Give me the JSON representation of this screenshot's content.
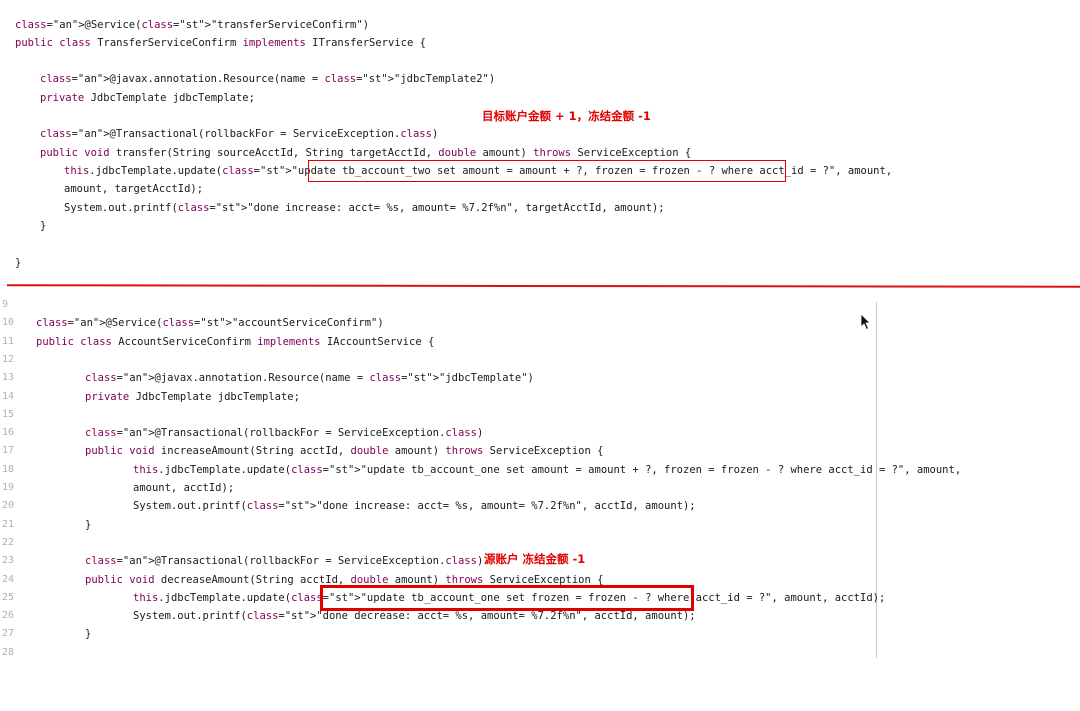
{
  "top": {
    "lines": [
      "@Service(\"transferServiceConfirm\")",
      "public class TransferServiceConfirm implements ITransferService {",
      "",
      "    @javax.annotation.Resource(name = \"jdbcTemplate2\")",
      "    private JdbcTemplate jdbcTemplate;",
      "",
      "    @Transactional(rollbackFor = ServiceException.class)",
      "    public void transfer(String sourceAcctId, String targetAcctId, double amount) throws ServiceException {",
      "            this.jdbcTemplate.update(\"update tb_account_two set amount = amount + ?, frozen = frozen - ? where acct_id = ?\", amount,",
      "                    amount, targetAcctId);",
      "            System.out.printf(\"done increase: acct= %s, amount= %7.2f%n\", targetAcctId, amount);",
      "    }",
      "",
      "}"
    ],
    "annotation": "目标账户金额 + 1，冻结金额 -1"
  },
  "bottom": {
    "line_numbers": [
      "9",
      "10",
      "11",
      "12",
      "13",
      "14",
      "15",
      "16",
      "17",
      "18",
      "19",
      "20",
      "21",
      "22",
      "23",
      "24",
      "25",
      "26",
      "27",
      "28"
    ],
    "lines": [
      "",
      "@Service(\"accountServiceConfirm\")",
      "public class AccountServiceConfirm implements IAccountService {",
      "",
      "    @javax.annotation.Resource(name = \"jdbcTemplate\")",
      "    private JdbcTemplate jdbcTemplate;",
      "",
      "    @Transactional(rollbackFor = ServiceException.class)",
      "    public void increaseAmount(String acctId, double amount) throws ServiceException {",
      "            this.jdbcTemplate.update(\"update tb_account_one set amount = amount + ?, frozen = frozen - ? where acct_id = ?\", amount,",
      "                    amount, acctId);",
      "            System.out.printf(\"done increase: acct= %s, amount= %7.2f%n\", acctId, amount);",
      "    }",
      "",
      "    @Transactional(rollbackFor = ServiceException.class)",
      "    public void decreaseAmount(String acctId, double amount) throws ServiceException {",
      "            this.jdbcTemplate.update(\"update tb_account_one set frozen = frozen - ? where acct_id = ?\", amount, acctId);",
      "            System.out.printf(\"done decrease: acct= %s, amount= %7.2f%n\", acctId, amount);",
      "    }",
      ""
    ],
    "annotation": "源账户 冻结金额 -1"
  },
  "colors": {
    "annotation": "#e00000",
    "divider": "#d11111"
  },
  "icons": [
    "mouse-cursor-icon"
  ]
}
